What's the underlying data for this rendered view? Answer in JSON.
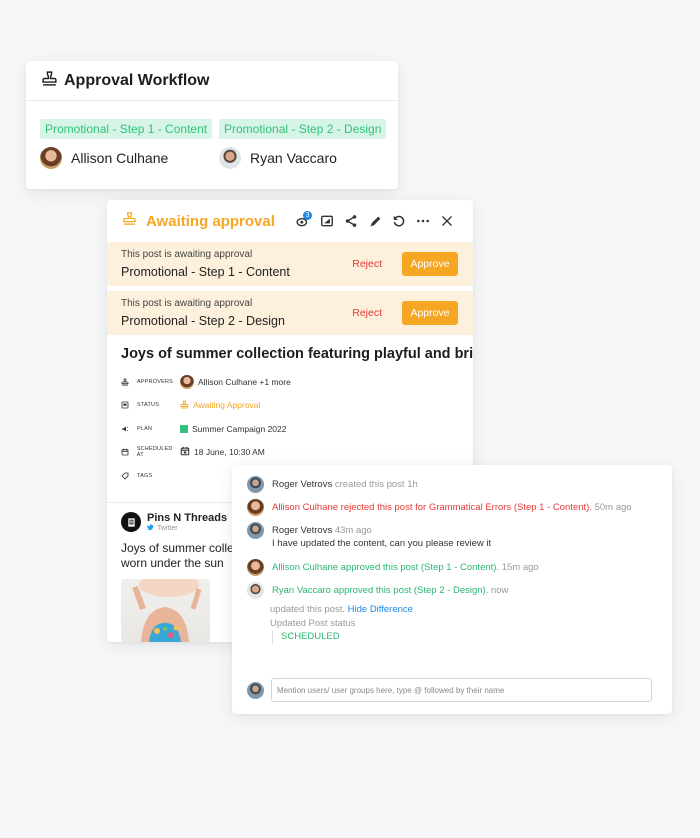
{
  "workflow": {
    "title": "Approval Workflow",
    "steps": [
      {
        "tag": "Promotional - Step 1 - Content",
        "approver": "Allison Culhane"
      },
      {
        "tag": "Promotional - Step 2 - Design",
        "approver": "Ryan Vaccaro"
      }
    ]
  },
  "post": {
    "status_title": "Awaiting approval",
    "toolbar": {
      "comment_badge": "3",
      "icons": [
        "comments-icon",
        "media-icon",
        "share-icon",
        "edit-icon",
        "undo-icon",
        "more-icon",
        "close-icon"
      ]
    },
    "approvals": [
      {
        "subtitle": "This post is awaiting approval",
        "step": "Promotional - Step 1 - Content",
        "reject": "Reject",
        "approve": "Approve"
      },
      {
        "subtitle": "This post is awaiting approval",
        "step": "Promotional - Step 2 - Design",
        "reject": "Reject",
        "approve": "Approve"
      }
    ],
    "title": "Joys of summer collection featuring playful and brig...",
    "meta": {
      "approvers": {
        "label": "Approvers",
        "value": "Allison Culhane +1 more"
      },
      "status": {
        "label": "Status",
        "value": "Awaiting Approval"
      },
      "plan": {
        "label": "Plan",
        "value": "Summer Campaign 2022"
      },
      "scheduled": {
        "label": "Scheduled at",
        "value": "18 June, 10:30 AM"
      },
      "tags": {
        "label": "Tags"
      }
    },
    "preview": {
      "account": "Pins N Threads",
      "network": "Twitter",
      "text": "Joys of summer collection featuring playful pieces to be worn under the sun"
    }
  },
  "activity": {
    "items": [
      {
        "user": "Roger Vetrovs",
        "action": "created this post",
        "time": "1h"
      },
      {
        "user": "Allison Culhane",
        "action": "rejected this post for Grammatical Errors (Step 1 - Content).",
        "time": "50m ago"
      },
      {
        "user": "Roger Vetrovs",
        "time": "43m ago",
        "comment": "I have updated the content, can you please review it"
      },
      {
        "user": "Allison Culhane",
        "action": "approved this post (Step 1 - Content).",
        "time": "15m ago"
      },
      {
        "user": "Ryan Vaccaro",
        "action": "approved this post (Step 2 - Design).",
        "time": "now"
      }
    ],
    "diff": {
      "updated": "updated this post.",
      "hide_link": "Hide Difference",
      "field": "Updated Post status",
      "new_value": "SCHEDULED"
    },
    "comment_placeholder": "Mention users/ user groups here, type @ followed by their name"
  },
  "colors": {
    "accent": "#f5a623",
    "approve_bg": "#fdf0dc",
    "tag_bg": "#d6f5e7",
    "green": "#2bb673",
    "red": "#e53935",
    "link": "#1e88e5"
  }
}
